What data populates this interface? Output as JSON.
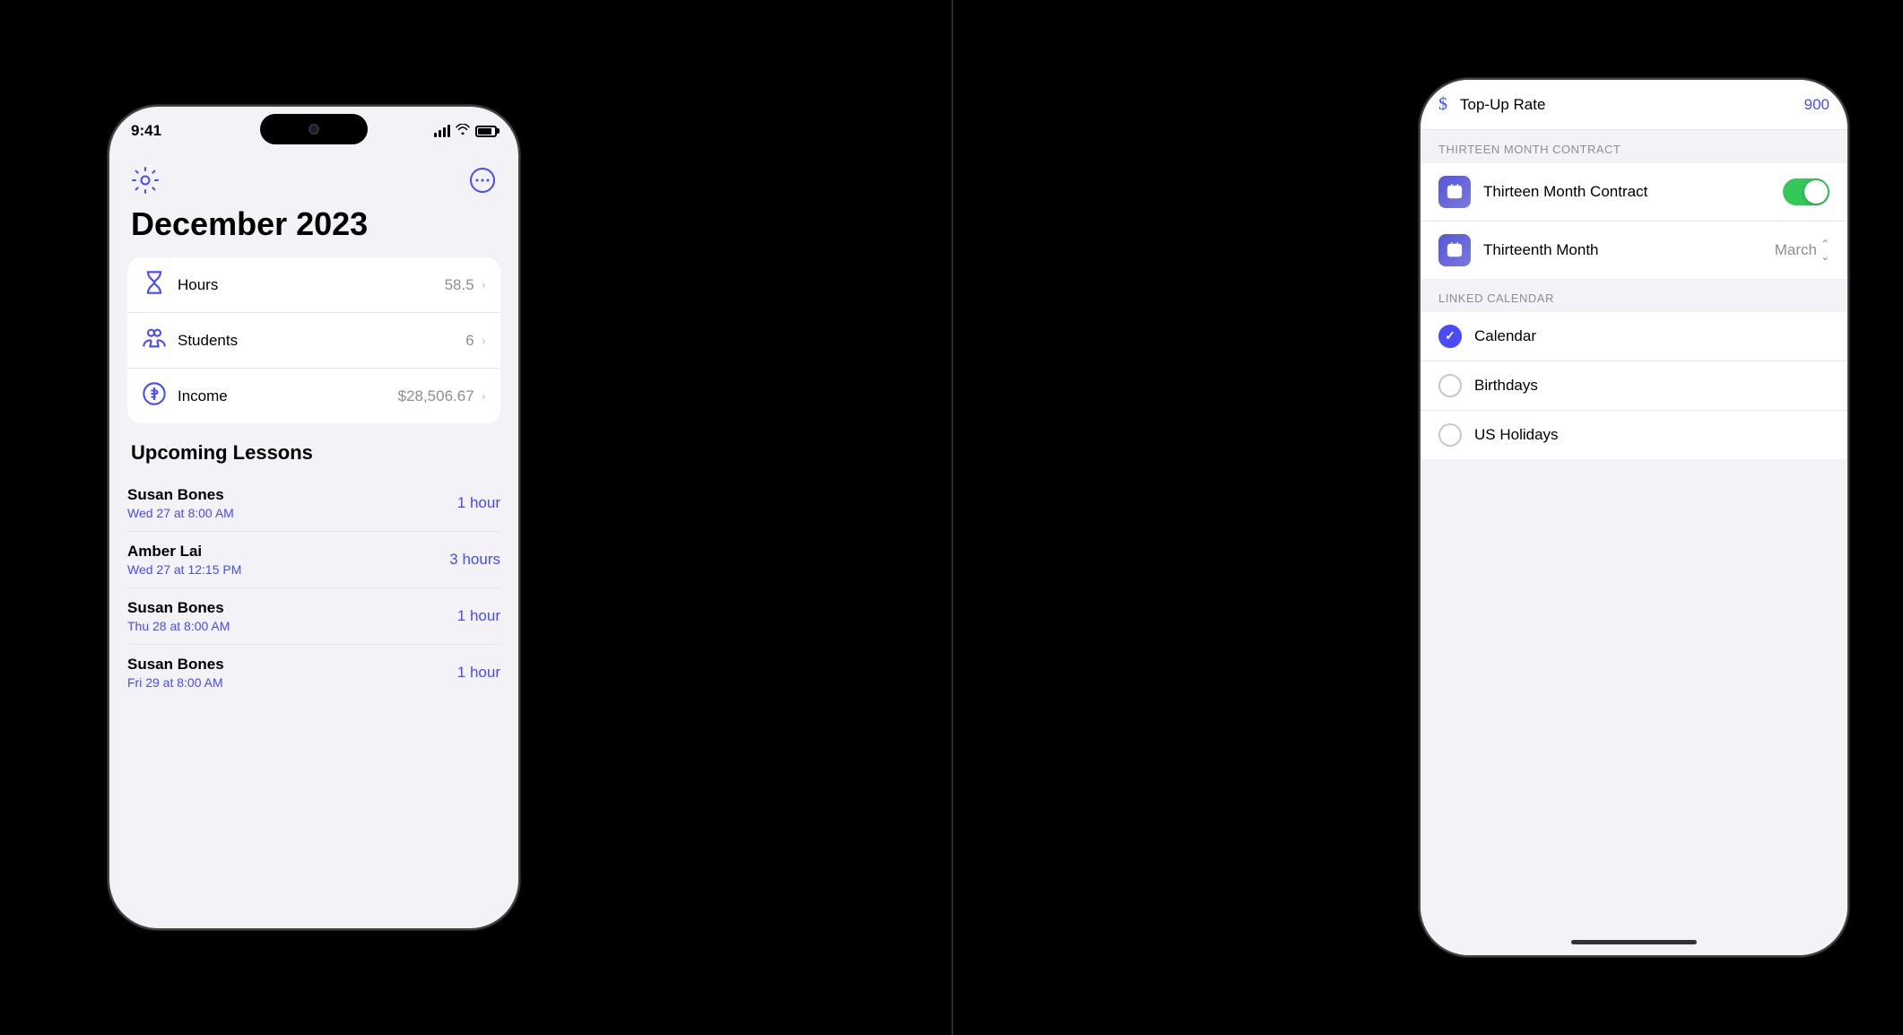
{
  "left_phone": {
    "status_time": "9:41",
    "title": "December 2023",
    "stats": [
      {
        "icon": "hourglass",
        "label": "Hours",
        "value": "58.5"
      },
      {
        "icon": "students",
        "label": "Students",
        "value": "6"
      },
      {
        "icon": "dollar",
        "label": "Income",
        "value": "$28,506.67"
      }
    ],
    "upcoming_section": "Upcoming Lessons",
    "lessons": [
      {
        "name": "Susan Bones",
        "time": "Wed 27 at 8:00 AM",
        "duration": "1 hour"
      },
      {
        "name": "Amber Lai",
        "time": "Wed 27 at 12:15 PM",
        "duration": "3 hours"
      },
      {
        "name": "Susan Bones",
        "time": "Thu 28 at 8:00 AM",
        "duration": "1 hour"
      },
      {
        "name": "Susan Bones",
        "time": "Fri 29 at 8:00 AM",
        "duration": "1 hour"
      }
    ]
  },
  "right_phone": {
    "topup_label": "Top-Up Rate",
    "topup_value": "900",
    "section_thirteen": "THIRTEEN MONTH CONTRACT",
    "thirteen_contract_label": "Thirteen Month Contract",
    "thirteenth_month_label": "Thirteenth Month",
    "thirteenth_month_value": "March",
    "section_calendar": "LINKED CALENDAR",
    "calendar_options": [
      {
        "label": "Calendar",
        "selected": true
      },
      {
        "label": "Birthdays",
        "selected": false
      },
      {
        "label": "US Holidays",
        "selected": false
      }
    ]
  }
}
